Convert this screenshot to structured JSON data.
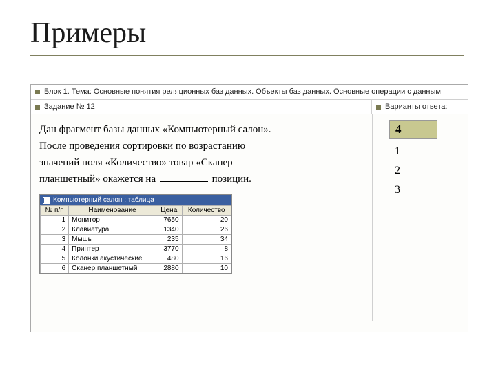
{
  "title": "Примеры",
  "topBar": "Блок 1. Тема: Основные понятия реляционных баз данных. Объекты баз данных. Основные операции с данным",
  "taskLabel": "Задание № 12",
  "answersLabel": "Варианты ответа:",
  "question": {
    "line1_a": "Дан фрагмент базы данных «Компьютерный салон».",
    "line2": "После проведения сортировки по возрастанию",
    "line3": "значений поля «Количество» товар «Сканер",
    "line4_a": "планшетный» окажется на",
    "line4_b": "позиции."
  },
  "dbTable": {
    "caption": "Компьютерный салон : таблица",
    "headers": [
      "№ п/п",
      "Наименование",
      "Цена",
      "Количество"
    ],
    "rows": [
      [
        "1",
        "Монитор",
        "7650",
        "20"
      ],
      [
        "2",
        "Клавиатура",
        "1340",
        "26"
      ],
      [
        "3",
        "Мышь",
        "235",
        "34"
      ],
      [
        "4",
        "Принтер",
        "3770",
        "8"
      ],
      [
        "5",
        "Колонки акустические",
        "480",
        "16"
      ],
      [
        "6",
        "Сканер планшетный",
        "2880",
        "10"
      ]
    ]
  },
  "answers": [
    "4",
    "1",
    "2",
    "3"
  ]
}
